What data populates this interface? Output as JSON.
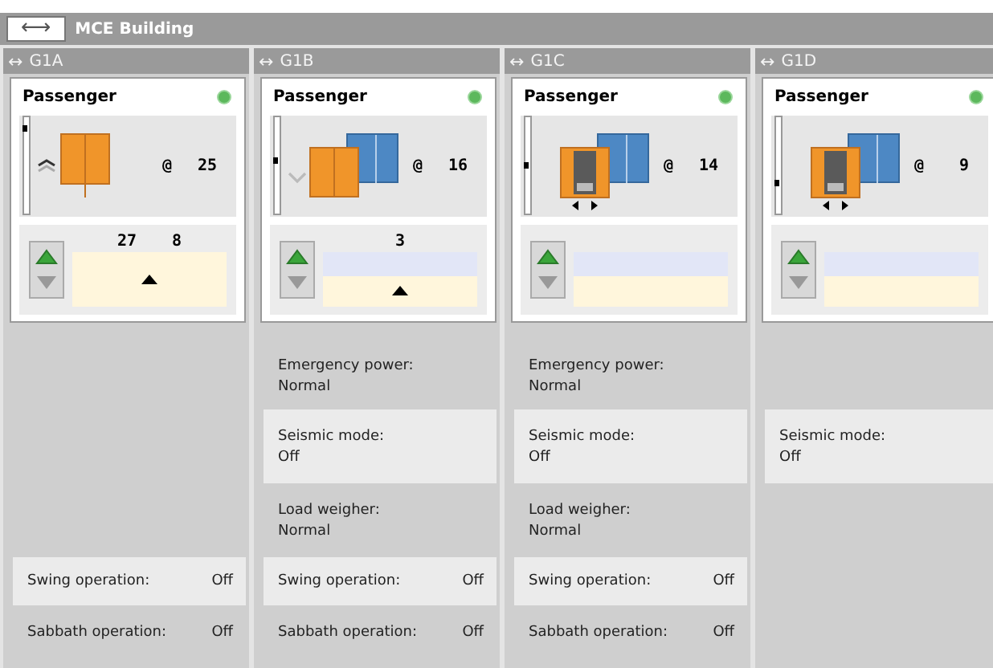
{
  "header": {
    "toggle": "⟷",
    "title": "MCE Building"
  },
  "groups": [
    {
      "toggle": "↔",
      "name": "G1A",
      "type": "Passenger",
      "online": true,
      "car": {
        "level": 0.92,
        "up_arrow": true,
        "down_arrow": false,
        "doors_open": false,
        "second_car": false,
        "at": "@",
        "floor": "25"
      },
      "calls": {
        "labels": [
          "27",
          "8"
        ],
        "upper_band": false,
        "marker": true
      },
      "status": [
        {
          "kind": "swing",
          "label": "Swing operation:",
          "value": "Off"
        },
        {
          "kind": "sabbath",
          "label": "Sabbath operation:",
          "value": "Off"
        }
      ]
    },
    {
      "toggle": "↔",
      "name": "G1B",
      "type": "Passenger",
      "online": true,
      "car": {
        "level": 0.55,
        "up_arrow": false,
        "down_arrow": true,
        "doors_open": false,
        "second_car": true,
        "at": "@",
        "floor": "16"
      },
      "calls": {
        "labels": [
          "3"
        ],
        "upper_band": true,
        "marker": true
      },
      "status": [
        {
          "kind": "emergency_power",
          "label": "Emergency power:",
          "value": "Normal"
        },
        {
          "kind": "seismic",
          "label": "Seismic mode:",
          "value": "Off"
        },
        {
          "kind": "load_weigher",
          "label": "Load weigher:",
          "value": "Normal"
        },
        {
          "kind": "swing",
          "label": "Swing operation:",
          "value": "Off"
        },
        {
          "kind": "sabbath",
          "label": "Sabbath operation:",
          "value": "Off"
        }
      ]
    },
    {
      "toggle": "↔",
      "name": "G1C",
      "type": "Passenger",
      "online": true,
      "car": {
        "level": 0.5,
        "up_arrow": false,
        "down_arrow": false,
        "doors_open": true,
        "second_car": true,
        "at": "@",
        "floor": "14"
      },
      "calls": {
        "upper_band": true,
        "marker": false
      },
      "status": [
        {
          "kind": "emergency_power",
          "label": "Emergency power:",
          "value": "Normal"
        },
        {
          "kind": "seismic",
          "label": "Seismic mode:",
          "value": "Off"
        },
        {
          "kind": "load_weigher",
          "label": "Load weigher:",
          "value": "Normal"
        },
        {
          "kind": "swing",
          "label": "Swing operation:",
          "value": "Off"
        },
        {
          "kind": "sabbath",
          "label": "Sabbath operation:",
          "value": "Off"
        }
      ]
    },
    {
      "toggle": "↔",
      "name": "G1D",
      "type": "Passenger",
      "online": true,
      "car": {
        "level": 0.3,
        "up_arrow": false,
        "down_arrow": false,
        "doors_open": true,
        "second_car": true,
        "at": "@",
        "floor": "9"
      },
      "calls": {
        "upper_band": true,
        "marker": false
      },
      "status": [
        {
          "kind": "seismic",
          "label": "Seismic mode:",
          "value": "Off"
        }
      ]
    }
  ]
}
